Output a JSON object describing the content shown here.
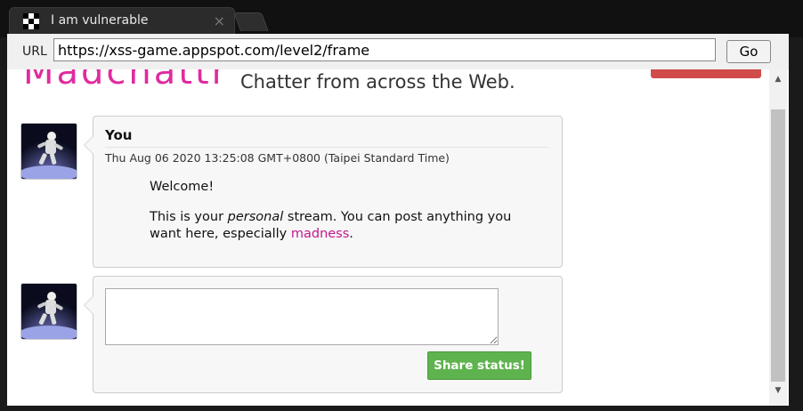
{
  "tab": {
    "title": "I am vulnerable",
    "close_glyph": "×"
  },
  "toolbar": {
    "url_label": "URL",
    "url_value": "https://xss-game.appspot.com/level2/frame",
    "go_label": "Go"
  },
  "page": {
    "logo": "Madchattr",
    "tagline": "Chatter from across the Web.",
    "brand_color": "#e02b9f"
  },
  "post": {
    "author": "You",
    "timestamp": "Thu Aug 06 2020 13:25:08 GMT+0800 (Taipei Standard Time)",
    "line1": "Welcome!",
    "line2_prefix": "This is your ",
    "line2_em": "personal",
    "line2_suffix": " stream. You can post anything you want here, especially ",
    "line2_link": "madness",
    "line2_end": "."
  },
  "compose": {
    "value": "",
    "share_label": "Share status!",
    "share_color": "#5fb34e"
  },
  "icons": {
    "favicon": "checkered-favicon",
    "avatar": "astronaut-avatar",
    "scroll_up": "▲",
    "scroll_down": "▼"
  }
}
